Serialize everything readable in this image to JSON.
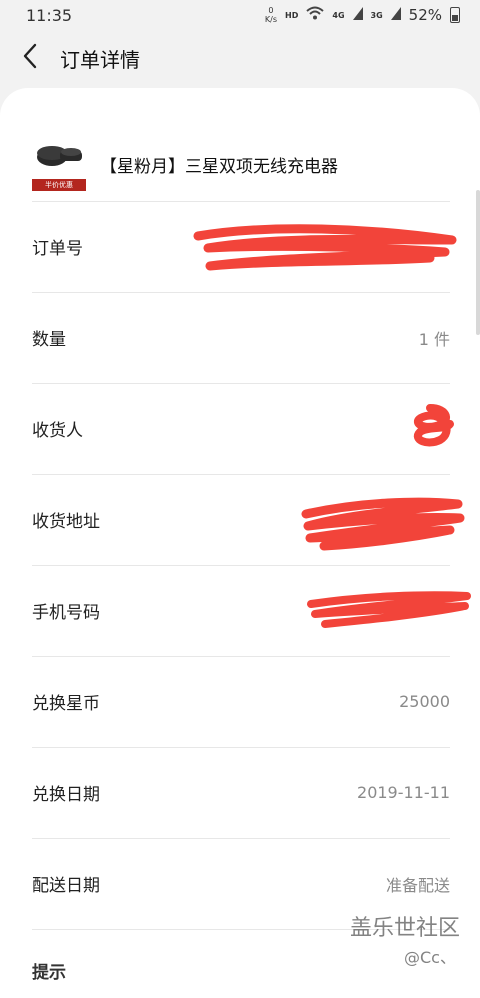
{
  "status": {
    "time": "11:35",
    "speed_value": "0",
    "speed_unit": "K/s",
    "hd": "HD",
    "net_4g": "4G",
    "net_3g": "3G",
    "battery": "52%"
  },
  "header": {
    "title": "订单详情"
  },
  "product": {
    "name": "【星粉月】三星双项无线充电器",
    "tag": "半价优惠"
  },
  "rows": [
    {
      "label": "订单号",
      "value": ""
    },
    {
      "label": "数量",
      "value": "1 件"
    },
    {
      "label": "收货人",
      "value": ""
    },
    {
      "label": "收货地址",
      "value": ""
    },
    {
      "label": "手机号码",
      "value": ""
    },
    {
      "label": "兑换星币",
      "value": "25000"
    },
    {
      "label": "兑换日期",
      "value": "2019-11-11"
    },
    {
      "label": "配送日期",
      "value": "准备配送"
    }
  ],
  "tips_label": "提示",
  "watermark": {
    "brand": "盖乐世社区",
    "user": "@Cc、"
  },
  "colors": {
    "redaction": "#f2443a",
    "card_bg": "#ffffff",
    "page_bg": "#f2f2f2"
  }
}
